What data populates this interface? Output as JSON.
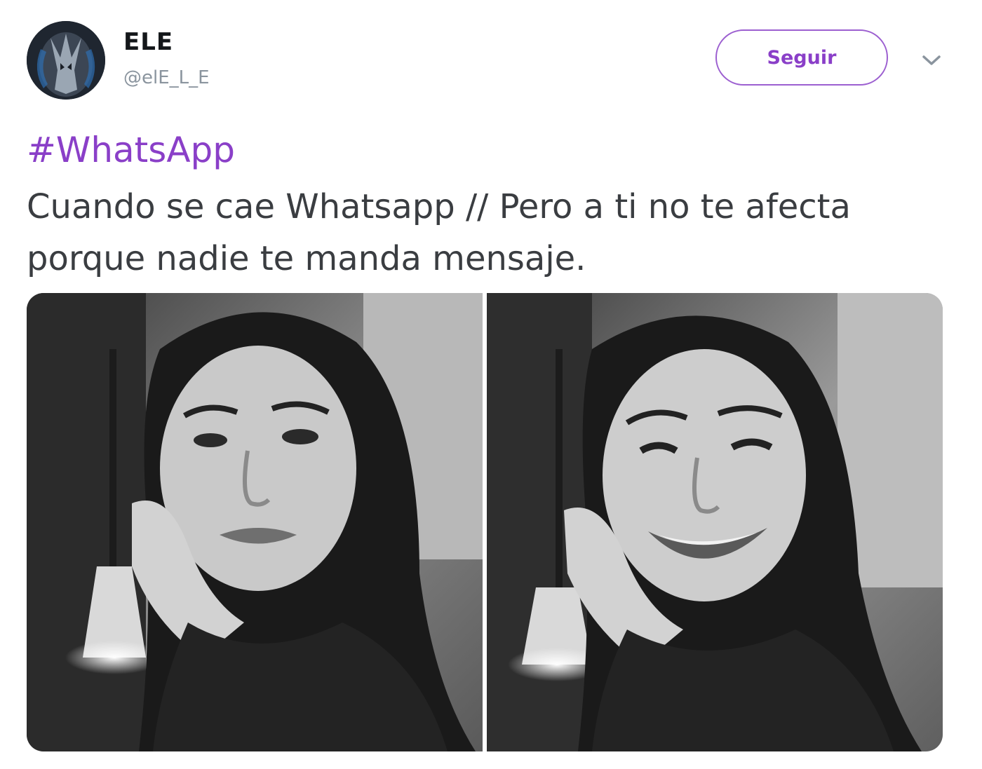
{
  "author": {
    "display_name": "ELE",
    "handle": "@elE_L_E",
    "avatar_icon": "masked-avatar-icon"
  },
  "follow_button": {
    "label": "Seguir",
    "color": "#8a3fc8"
  },
  "menu_icon": "chevron-down-icon",
  "tweet": {
    "hashtag": "#WhatsApp",
    "text": "Cuando se cae Whatsapp // Pero a ti no te afecta porque nadie te manda mensaje.",
    "hashtag_color": "#8a3fc8"
  },
  "media": {
    "photos": [
      {
        "name": "photo-sad-expression"
      },
      {
        "name": "photo-smiling-expression"
      }
    ]
  }
}
